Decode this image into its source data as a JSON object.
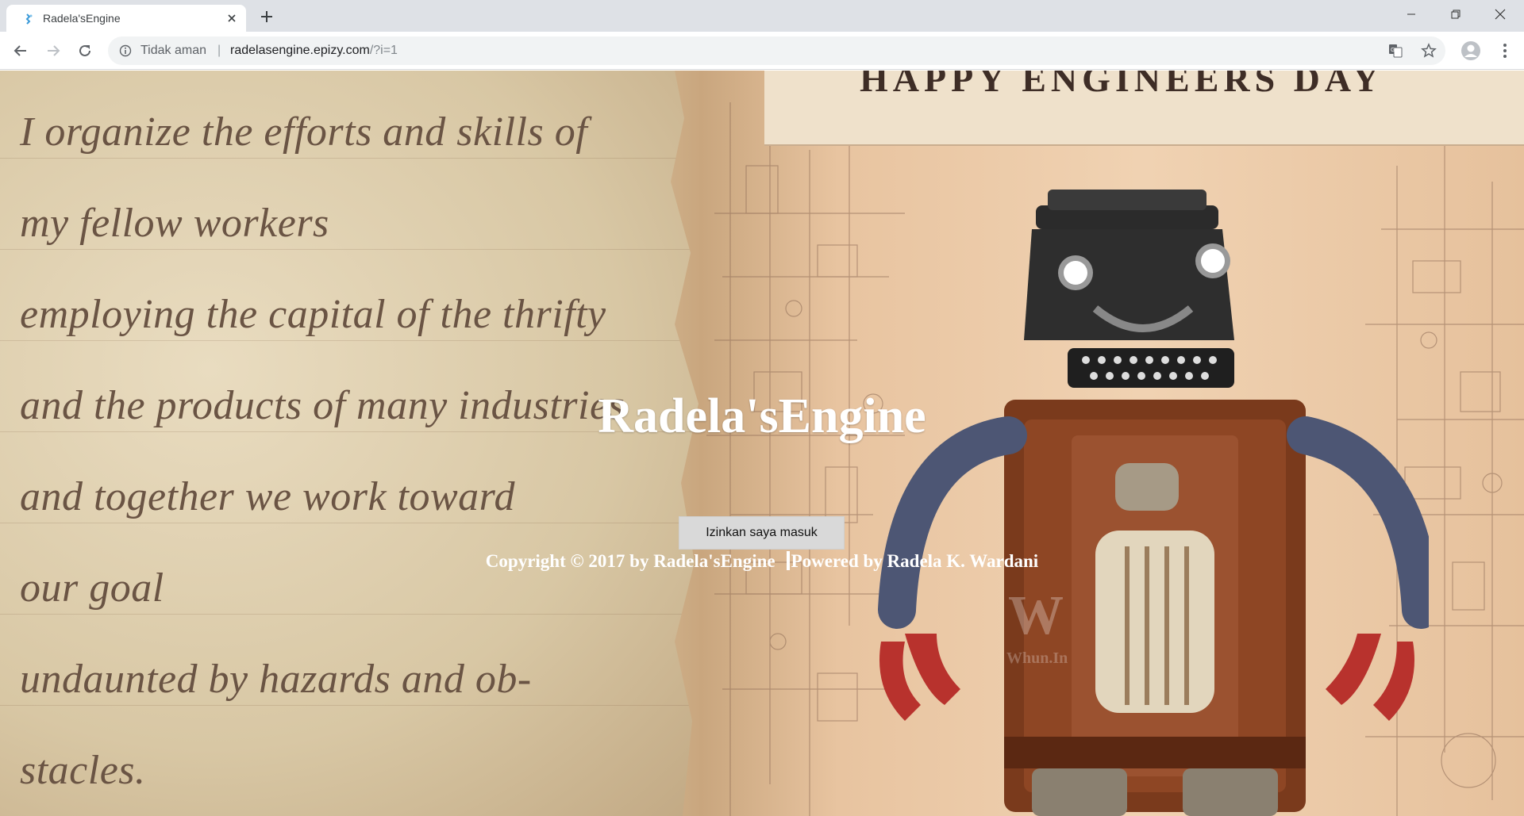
{
  "browser": {
    "tab": {
      "title": "Radela'sEngine",
      "favicon": "site-favicon-icon",
      "close_icon": "close-icon"
    },
    "new_tab_icon": "plus-icon",
    "window_controls": [
      "minimize-icon",
      "restore-icon",
      "close-icon"
    ],
    "nav": {
      "back_icon": "arrow-left-icon",
      "forward_icon": "arrow-right-icon",
      "reload_icon": "reload-icon"
    },
    "omnibox": {
      "security_icon": "info-icon",
      "security_label": "Tidak aman",
      "separator": "|",
      "url_host": "radelasengine.epizy.com",
      "url_path": "/?i=1",
      "translate_icon": "translate-icon",
      "bookmark_icon": "star-icon"
    },
    "profile_icon": "profile-avatar-icon",
    "menu_icon": "kebab-menu-icon"
  },
  "page": {
    "background_poem": [
      "I organize the efforts and skills of",
      "my fellow workers",
      "employing the capital of the thrifty",
      "and the products of many industries",
      "and together we work toward",
      "our goal",
      "undaunted by hazards and ob-",
      "stacles."
    ],
    "banner_text": "HAPPY ENGINEERS DAY",
    "watermark": {
      "mark": "W",
      "sub": "Whun.In"
    },
    "site_title": "Radela'sEngine",
    "login_button": "Izinkan saya masuk",
    "footer": {
      "copyright": "Copyright © 2017 by Radela'sEngine",
      "powered": "Powered by Radela K. Wardani"
    },
    "colors": {
      "chrome_tabstrip": "#dee1e6",
      "omnibox_bg": "#f1f3f4",
      "overlay_text": "#ffffff",
      "button_bg": "#d9d9d9",
      "poem_text": "#6a5444"
    }
  }
}
